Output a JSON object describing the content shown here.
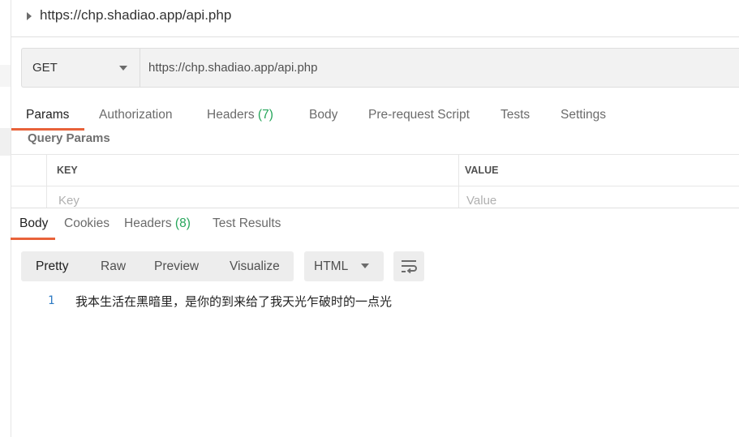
{
  "request": {
    "title": "https://chp.shadiao.app/api.php",
    "method": "GET",
    "url": "https://chp.shadiao.app/api.php"
  },
  "request_tabs": [
    {
      "label": "Params",
      "count": ""
    },
    {
      "label": "Authorization",
      "count": ""
    },
    {
      "label": "Headers",
      "count": "(7)"
    },
    {
      "label": "Body",
      "count": ""
    },
    {
      "label": "Pre-request Script",
      "count": ""
    },
    {
      "label": "Tests",
      "count": ""
    },
    {
      "label": "Settings",
      "count": ""
    }
  ],
  "query_params": {
    "title": "Query Params",
    "key_header": "KEY",
    "value_header": "VALUE",
    "key_placeholder": "Key",
    "value_placeholder": "Value"
  },
  "response_tabs": [
    {
      "label": "Body",
      "count": ""
    },
    {
      "label": "Cookies",
      "count": ""
    },
    {
      "label": "Headers",
      "count": "(8)"
    },
    {
      "label": "Test Results",
      "count": ""
    }
  ],
  "view_modes": [
    "Pretty",
    "Raw",
    "Preview",
    "Visualize"
  ],
  "format": "HTML",
  "icons": {
    "wrap": "wrap-lines-icon",
    "expand": "caret-right-icon",
    "dropdown": "chevron-down-icon"
  },
  "accent_color": "#e8623a",
  "response_body": [
    {
      "line": "1",
      "text": "我本生活在黑暗里，是你的到来给了我天光乍破时的一点光"
    }
  ]
}
